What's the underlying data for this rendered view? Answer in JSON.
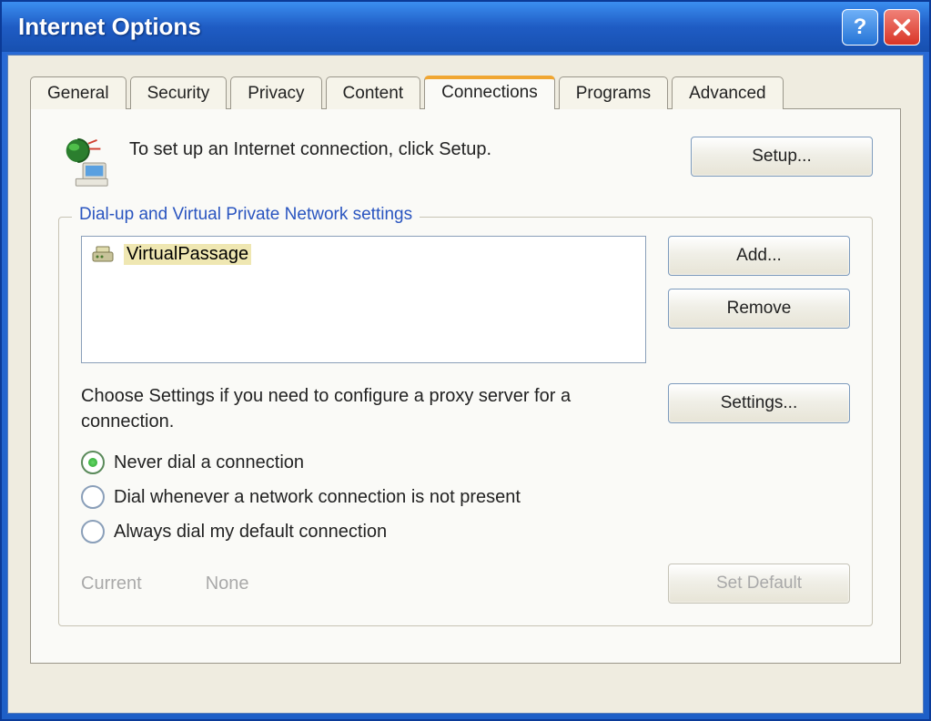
{
  "window": {
    "title": "Internet Options"
  },
  "tabs": {
    "items": [
      {
        "label": "General"
      },
      {
        "label": "Security"
      },
      {
        "label": "Privacy"
      },
      {
        "label": "Content"
      },
      {
        "label": "Connections",
        "active": true
      },
      {
        "label": "Programs"
      },
      {
        "label": "Advanced"
      }
    ]
  },
  "setup": {
    "text": "To set up an Internet connection, click Setup.",
    "button": "Setup..."
  },
  "dialup": {
    "legend": "Dial-up and Virtual Private Network settings",
    "connections": [
      {
        "name": "VirtualPassage",
        "selected": true
      }
    ],
    "add_button": "Add...",
    "remove_button": "Remove",
    "proxy_text": "Choose Settings if you need to configure a proxy server for a connection.",
    "settings_button": "Settings...",
    "radios": {
      "never": "Never dial a connection",
      "when_absent": "Dial whenever a network connection is not present",
      "always": "Always dial my default connection",
      "selected": "never"
    },
    "current_label": "Current",
    "current_value": "None",
    "set_default_button": "Set Default"
  }
}
